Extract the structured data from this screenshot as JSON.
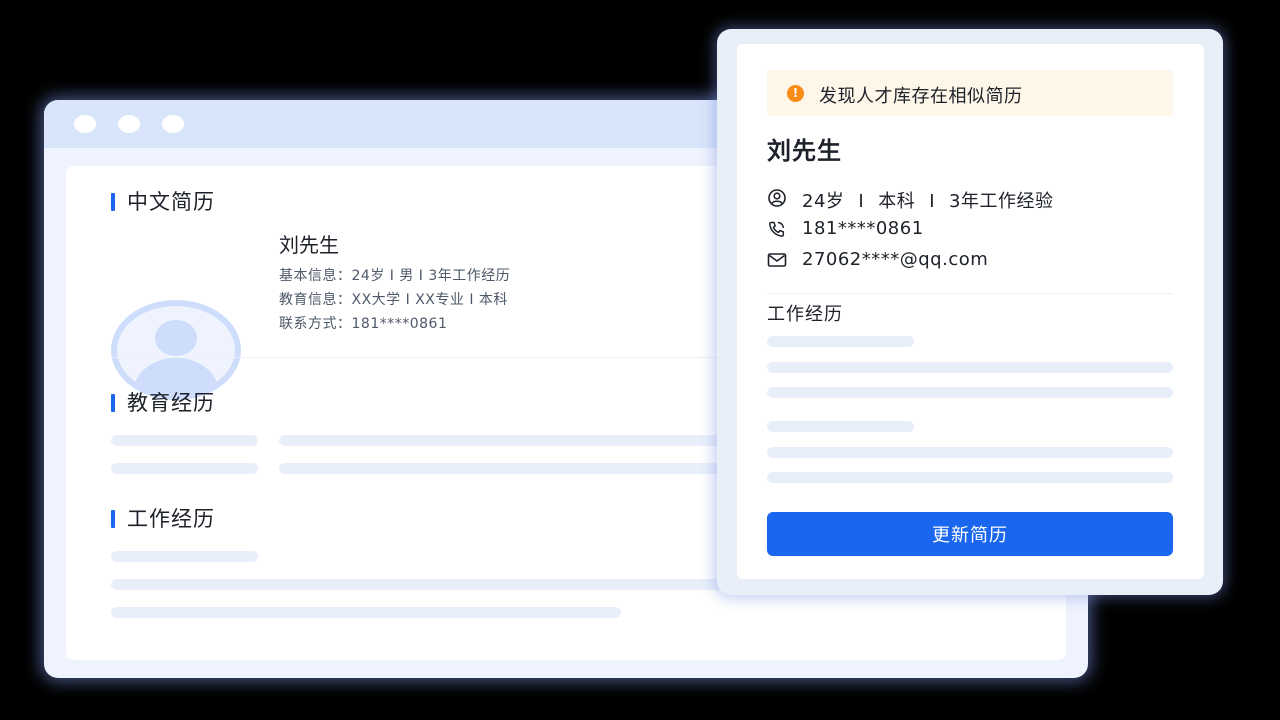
{
  "resume": {
    "sections": {
      "chinese_resume": "中文简历",
      "education": "教育经历",
      "work": "工作经历"
    },
    "profile": {
      "name": "刘先生",
      "basic_info": "基本信息：24岁 I 男 I 3年工作经历",
      "education_info": "教育信息：XX大学 I XX专业 I 本科",
      "contact": "联系方式：181****0861"
    }
  },
  "similar_card": {
    "warning": "发现人才库存在相似简历",
    "warning_icon": "exclamation-icon",
    "name": "刘先生",
    "age": "24岁",
    "degree": "本科",
    "experience": "3年工作经验",
    "separator": "I",
    "phone": "181****0861",
    "email": "27062****@qq.com",
    "work_section": "工作经历",
    "update_button": "更新简历"
  },
  "colors": {
    "accent": "#1a66ee",
    "warning": "#fa8c16",
    "warning_bg": "#fdf6e9",
    "skeleton": "#e9effa"
  }
}
